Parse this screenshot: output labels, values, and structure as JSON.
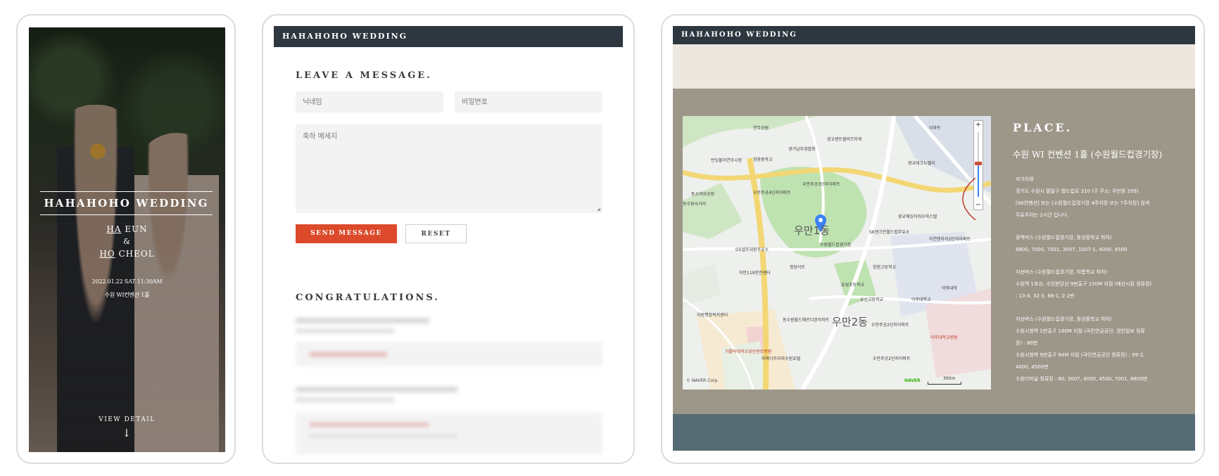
{
  "hero": {
    "title": "HAHAHOHO WEDDING",
    "groom_prefix": "HA",
    "groom_name": "EUN",
    "ampersand": "&",
    "bride_prefix": "HO",
    "bride_name": "CHEOL",
    "datetime": "2022.01.22 SAT 11:30AM",
    "venue": "수원 WI컨벤션 1홀",
    "view_detail": "VIEW DETAIL",
    "arrow": "↓"
  },
  "guestbook": {
    "header": "HAHAHOHO WEDDING",
    "leave_title": "LEAVE A MESSAGE.",
    "nickname_placeholder": "닉네임",
    "password_placeholder": "비밀번호",
    "message_placeholder": "축하 메세지",
    "send_label": "SEND MESSAGE",
    "reset_label": "RESET",
    "congrats_title": "CONGRATULATIONS."
  },
  "place": {
    "header": "HAHAHOHO WEDDING",
    "title": "PLACE.",
    "venue_name": "수원 WI 컨벤션 1홀 (수원월드컵경기장)",
    "car": {
      "heading": "자가차량",
      "lines": [
        "경기도 수원시 팔달구 월드컵로 310 (구 주소: 우만동 209)",
        "[WI컨벤션] 또는 [수원월드컵경기장 4주차장 또는 7주차장] 검색",
        "무료주차는 2시간 입니다."
      ]
    },
    "express_bus": {
      "heading": "광역버스 (수원월드컵경기장, 동성중학교 하차)",
      "lines": [
        "8800, 7000, 7001, 3007, 1007-1, 4000, 4500"
      ]
    },
    "local_bus1": {
      "heading": "지선버스 (수원월드컵경기장, 아름학교 하차)",
      "lines": [
        "수원역 1호선, 수인분당선 9번출구 150M 지점 (매산시장 정류장)",
        ": 13-4, 32-3, 88-1, 2-2번"
      ]
    },
    "local_bus2": {
      "heading": "지선버스 (수원월드컵경기장, 동성중학교 하차)",
      "lines": [
        "수원시청역 1번출구 180M 지점 (국민연금공단, 경인일보 정류",
        "장) : 80번",
        "수원시청역 9번출구 94M 지점 (국민연금공단 정류장) : 99-2,",
        "4000, 4500번",
        "수원터미널 정류장 : 80, 3007, 4000, 4500, 7001, 8800번"
      ]
    },
    "map": {
      "copyright": "© NAVER Corp.",
      "naver": "NAVER",
      "scale": "300m",
      "zoom_in": "+",
      "zoom_out": "−",
      "labels": [
        "연무공원",
        "이마트",
        "광교센트럴비즈타워",
        "반딧불이연무시장",
        "경기남부경찰청",
        "창용중학교",
        "광교테크노밸리",
        "동소여위공원",
        "우만주공4단지아파트",
        "우만주공3단지아파트",
        "광교에듀타워오피스텔",
        "동수원사거리",
        "SK앤크린월드컵주유소",
        "자연앤자이2단지아파트",
        "우만1동",
        "수원월드컵경기장",
        "GS엘프대원주유소",
        "청당아트",
        "창현고등학교",
        "지만119안전센터",
        "효성초등학교",
        "유신고등학교",
        "아주대학교",
        "약학대학",
        "우만2동",
        "우만주공2단지아파트",
        "동수원월드메르디앙아파트",
        "아주대학교병원",
        "가톨릭대학교성빈센트병원",
        "라마다프라자수원호텔",
        "우만주공2단지아파트",
        "동수원사거리",
        "자동행정복지센터"
      ]
    },
    "colors": {
      "beige": "#ece8e0",
      "taupe": "#9d978a",
      "slate": "#556a72",
      "send_button": "#dc4a2b",
      "header_bar": "#2e3640"
    }
  }
}
